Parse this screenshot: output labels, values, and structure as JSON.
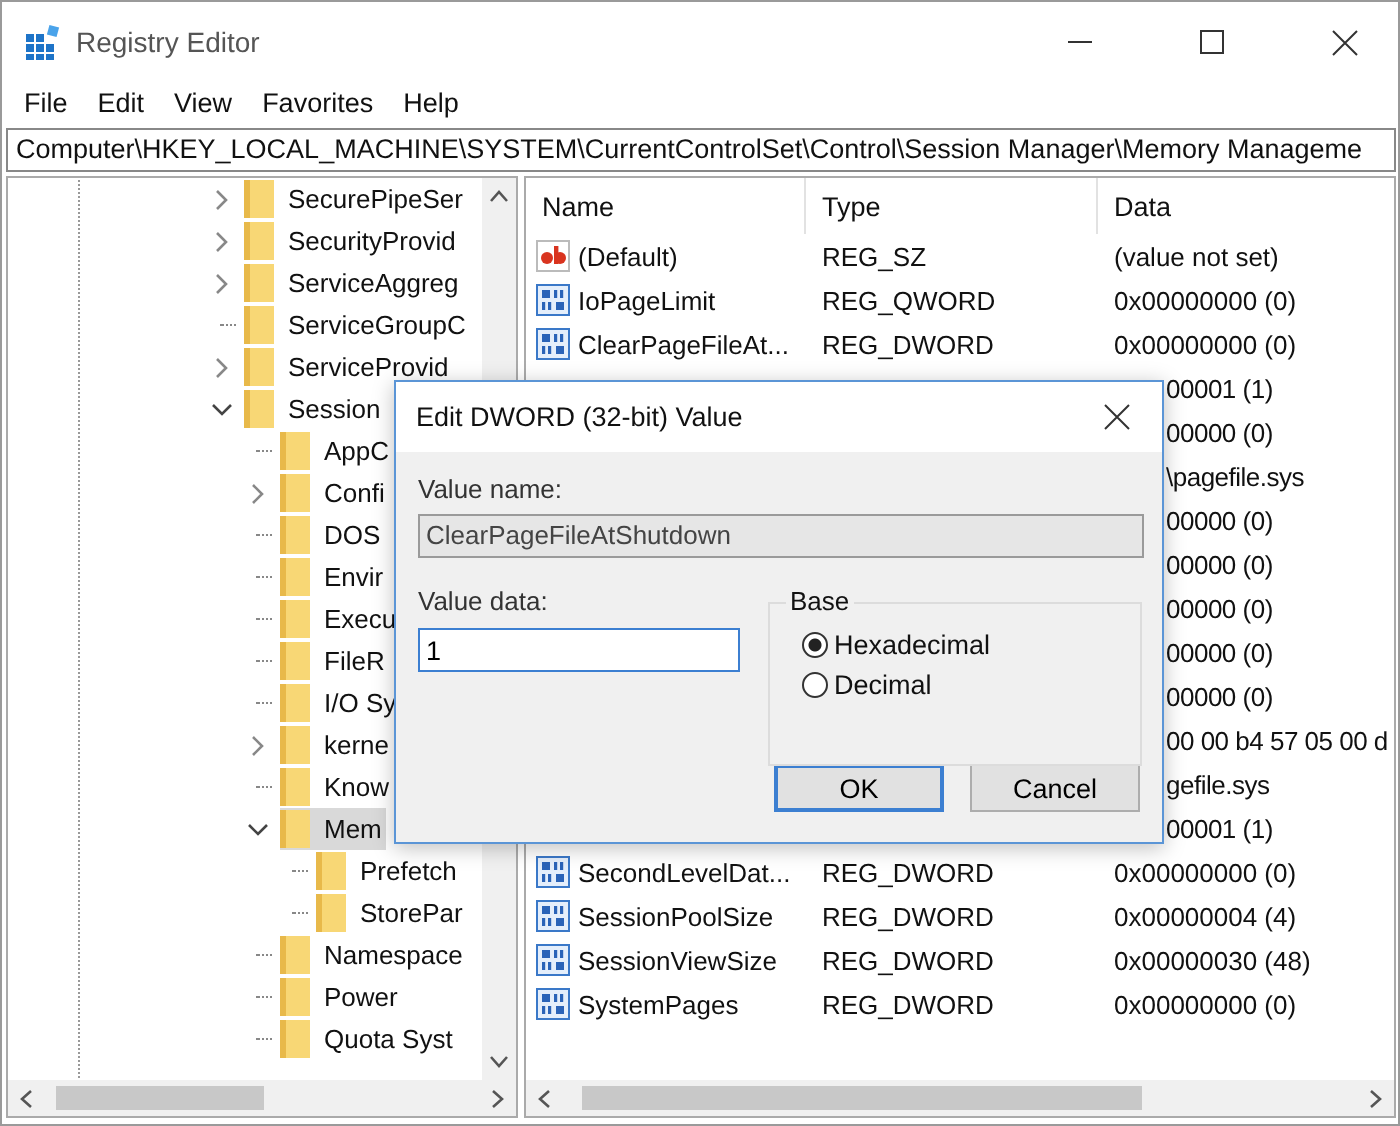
{
  "window": {
    "title": "Registry Editor"
  },
  "menu": [
    "File",
    "Edit",
    "View",
    "Favorites",
    "Help"
  ],
  "address_bar": {
    "value": "Computer\\HKEY_LOCAL_MACHINE\\SYSTEM\\CurrentControlSet\\Control\\Session Manager\\Memory Manageme"
  },
  "tree": [
    {
      "label": "SecurePipeSer",
      "expandable": true,
      "expanded": false,
      "selected": false
    },
    {
      "label": "SecurityProvid",
      "expandable": true,
      "expanded": false,
      "selected": false
    },
    {
      "label": "ServiceAggreg",
      "expandable": true,
      "expanded": false,
      "selected": false
    },
    {
      "label": "ServiceGroupC",
      "expandable": false,
      "selected": false
    },
    {
      "label": "ServiceProvid",
      "expandable": true,
      "expanded": false,
      "selected": false
    },
    {
      "label": "Session",
      "expandable": true,
      "expanded": true,
      "selected": false,
      "children": [
        {
          "label": "AppC",
          "expandable": false,
          "selected": false
        },
        {
          "label": "Confi",
          "expandable": true,
          "expanded": false,
          "selected": false
        },
        {
          "label": "DOS",
          "expandable": false,
          "selected": false
        },
        {
          "label": "Envir",
          "expandable": false,
          "selected": false
        },
        {
          "label": "Execu",
          "expandable": false,
          "selected": false
        },
        {
          "label": "FileR",
          "expandable": false,
          "selected": false
        },
        {
          "label": "I/O Sy",
          "expandable": false,
          "selected": false
        },
        {
          "label": "kerne",
          "expandable": true,
          "expanded": false,
          "selected": false
        },
        {
          "label": "Know",
          "expandable": false,
          "selected": false
        },
        {
          "label": "Mem",
          "expandable": true,
          "expanded": true,
          "selected": true,
          "children": [
            {
              "label": "Prefetch",
              "expandable": false,
              "selected": false
            },
            {
              "label": "StorePar",
              "expandable": false,
              "selected": false
            }
          ]
        },
        {
          "label": "Namespace",
          "expandable": false,
          "selected": false
        },
        {
          "label": "Power",
          "expandable": false,
          "selected": false
        },
        {
          "label": "Quota Syst",
          "expandable": false,
          "selected": false
        }
      ]
    }
  ],
  "values_list": {
    "columns": [
      "Name",
      "Type",
      "Data"
    ],
    "rows": [
      {
        "kind": "string",
        "name": "(Default)",
        "type": "REG_SZ",
        "data": "(value not set)"
      },
      {
        "kind": "binary",
        "name": "IoPageLimit",
        "type": "REG_QWORD",
        "data": "0x00000000 (0)"
      },
      {
        "kind": "binary",
        "name": "ClearPageFileAt...",
        "type": "REG_DWORD",
        "data": "0x00000000 (0)"
      },
      {
        "kind": "covered",
        "data": "00001 (1)"
      },
      {
        "kind": "covered",
        "data": "00000 (0)"
      },
      {
        "kind": "covered",
        "data": "\\pagefile.sys"
      },
      {
        "kind": "covered",
        "data": "00000 (0)"
      },
      {
        "kind": "covered",
        "data": "00000 (0)"
      },
      {
        "kind": "covered",
        "data": "00000 (0)"
      },
      {
        "kind": "covered",
        "data": "00000 (0)"
      },
      {
        "kind": "covered",
        "data": "00000 (0)"
      },
      {
        "kind": "covered",
        "data": "00 00 b4 57 05 00 d"
      },
      {
        "kind": "covered",
        "data": "gefile.sys"
      },
      {
        "kind": "covered",
        "data": "00001 (1)"
      },
      {
        "kind": "binary",
        "name": "SecondLevelDat...",
        "type": "REG_DWORD",
        "data": "0x00000000 (0)"
      },
      {
        "kind": "binary",
        "name": "SessionPoolSize",
        "type": "REG_DWORD",
        "data": "0x00000004 (4)"
      },
      {
        "kind": "binary",
        "name": "SessionViewSize",
        "type": "REG_DWORD",
        "data": "0x00000030 (48)"
      },
      {
        "kind": "binary",
        "name": "SystemPages",
        "type": "REG_DWORD",
        "data": "0x00000000 (0)"
      }
    ]
  },
  "dialog": {
    "title": "Edit DWORD (32-bit) Value",
    "name_label": "Value name:",
    "name_value": "ClearPageFileAtShutdown",
    "data_label": "Value data:",
    "data_value": "1",
    "base_label": "Base",
    "base_options": [
      {
        "label": "Hexadecimal",
        "selected": true
      },
      {
        "label": "Decimal",
        "selected": false
      }
    ],
    "buttons": [
      {
        "label": "OK",
        "default": true
      },
      {
        "label": "Cancel",
        "default": false
      }
    ]
  }
}
